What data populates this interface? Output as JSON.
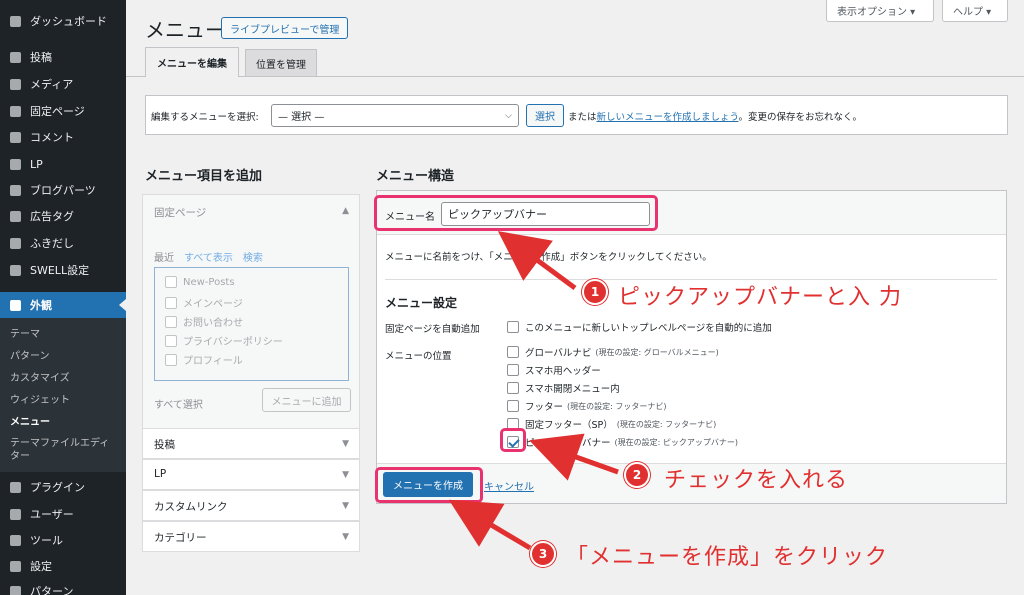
{
  "sidebar": {
    "items": [
      {
        "label": "ダッシュボード",
        "icon": "dashboard-icon"
      },
      {
        "label": "投稿",
        "icon": "pin-icon"
      },
      {
        "label": "メディア",
        "icon": "media-icon"
      },
      {
        "label": "固定ページ",
        "icon": "page-icon"
      },
      {
        "label": "コメント",
        "icon": "comment-icon"
      },
      {
        "label": "LP",
        "icon": "document-icon"
      },
      {
        "label": "ブログパーツ",
        "icon": "grid-icon"
      },
      {
        "label": "広告タグ",
        "icon": "ad-icon"
      },
      {
        "label": "ふきだし",
        "icon": "bubble-icon"
      },
      {
        "label": "SWELL設定",
        "icon": "swell-icon"
      },
      {
        "label": "外観",
        "icon": "brush-icon"
      }
    ],
    "submenu": [
      "テーマ",
      "パターン",
      "カスタマイズ",
      "ウィジェット",
      "メニュー",
      "テーマファイルエディター"
    ],
    "bottom_items": [
      {
        "label": "プラグイン",
        "icon": "plugin-icon"
      },
      {
        "label": "ユーザー",
        "icon": "user-icon"
      },
      {
        "label": "ツール",
        "icon": "wrench-icon"
      },
      {
        "label": "設定",
        "icon": "settings-icon"
      },
      {
        "label": "パターン",
        "icon": "pattern-icon"
      }
    ]
  },
  "header": {
    "title": "メニュー",
    "live_preview": "ライブプレビューで管理",
    "screen_options": "表示オプション ▾",
    "help": "ヘルプ ▾"
  },
  "tabs": {
    "edit": "メニューを編集",
    "locations": "位置を管理"
  },
  "select_bar": {
    "label": "編集するメニューを選択:",
    "value": "— 選択 —",
    "button": "選択",
    "note_pre": "または",
    "note_link": "新しいメニューを作成しましょう",
    "note_post": "。変更の保存をお忘れなく。"
  },
  "add_items": {
    "title": "メニュー項目を追加",
    "pages": {
      "title": "固定ページ",
      "tabs": [
        "最近",
        "すべて表示",
        "検索"
      ],
      "items": [
        "New-Posts",
        "メインページ",
        "お問い合わせ",
        "プライバシーポリシー",
        "プロフィール"
      ],
      "select_all": "すべて選択",
      "add_button": "メニューに追加"
    },
    "sections": [
      "投稿",
      "LP",
      "カスタムリンク",
      "カテゴリー"
    ]
  },
  "structure": {
    "title": "メニュー構造",
    "name_label": "メニュー名",
    "name_value": "ピックアップバナー",
    "description": "メニューに名前をつけ、「メニューを作成」ボタンをクリックしてください。",
    "settings_title": "メニュー設定",
    "auto_add_label": "固定ページを自動追加",
    "auto_add_option": "このメニューに新しいトップレベルページを自動的に追加",
    "location_label": "メニューの位置",
    "locations": [
      {
        "name": "グローバルナビ",
        "note": "(現在の設定: グローバルメニュー)",
        "checked": false
      },
      {
        "name": "スマホ用ヘッダー",
        "note": "",
        "checked": false
      },
      {
        "name": "スマホ開閉メニュー内",
        "note": "",
        "checked": false
      },
      {
        "name": "フッター",
        "note": "(現在の設定: フッターナビ)",
        "checked": false
      },
      {
        "name": "固定フッター（SP）",
        "note": "(現在の設定: フッターナビ)",
        "checked": false
      },
      {
        "name": "ピックアップバナー",
        "note": "(現在の設定: ピックアップバナー)",
        "checked": true
      }
    ],
    "create_button": "メニューを作成",
    "cancel": "キャンセル"
  },
  "annotations": [
    {
      "num": "1",
      "text": "ピックアップバナーと入 力"
    },
    {
      "num": "2",
      "text": "チェックを入れる"
    },
    {
      "num": "3",
      "text": "「メニューを作成」をクリック"
    }
  ],
  "colors": {
    "highlight": "#e8336f",
    "badge": "#e0302f",
    "accent": "#2271b1"
  }
}
